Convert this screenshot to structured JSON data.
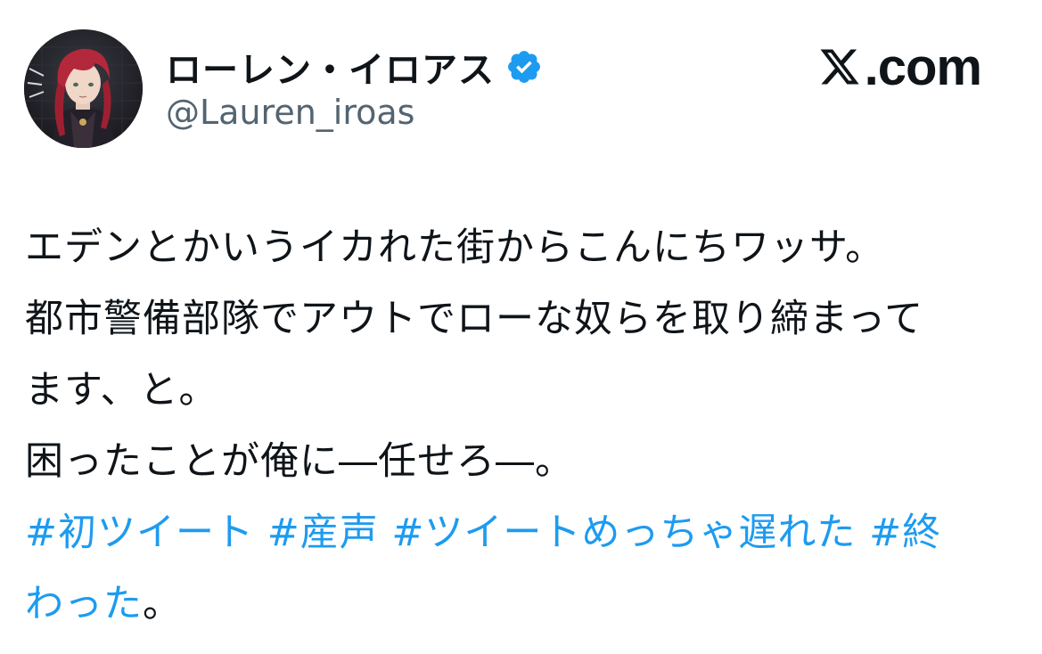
{
  "author": {
    "display_name": "ローレン・イロアス",
    "handle": "@Lauren_iroas",
    "verified": true,
    "avatar_icon": "profile-avatar"
  },
  "brand": {
    "logo_icon": "x-logo-icon",
    "text": ".com"
  },
  "tweet": {
    "lines": [
      "エデンとかいうイカれた街からこんにちワッサ。",
      "都市警備部隊でアウトでローな奴らを取り締まって",
      "ます、と。",
      "困ったことが俺に―任せろ―。"
    ],
    "hashtags": {
      "tag1": "#初ツイート",
      "tag2": "#産声",
      "tag3": "#ツイートめっちゃ遅れた",
      "tag4_part1": "#終",
      "tag4_part2": "わった",
      "tail": "。"
    }
  },
  "colors": {
    "link": "#1d9bf0",
    "text": "#0f1419",
    "secondary": "#536471",
    "verified_badge": "#1d9bf0"
  }
}
